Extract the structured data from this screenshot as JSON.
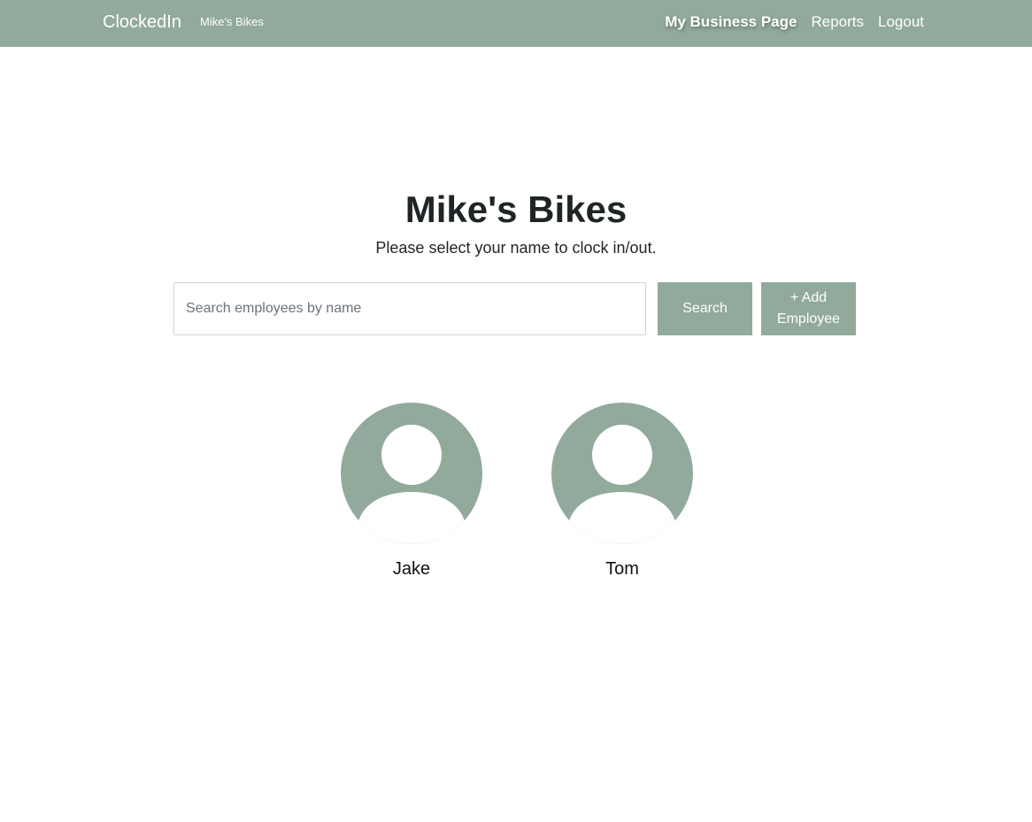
{
  "nav": {
    "brand": "ClockedIn",
    "business": "Mike's Bikes",
    "links": [
      {
        "label": "My Business Page",
        "active": true
      },
      {
        "label": "Reports",
        "active": false
      },
      {
        "label": "Logout",
        "active": false
      }
    ]
  },
  "main": {
    "title": "Mike's Bikes",
    "subtitle": "Please select your name to clock in/out.",
    "search": {
      "placeholder": "Search employees by name",
      "value": "",
      "button_label": "Search"
    },
    "add_button_label": "+ Add Employee",
    "employees": [
      {
        "name": "Jake",
        "icon": "user-avatar-icon"
      },
      {
        "name": "Tom",
        "icon": "user-avatar-icon"
      }
    ]
  },
  "colors": {
    "accent": "#92aa9c",
    "text": "#1f2426"
  }
}
